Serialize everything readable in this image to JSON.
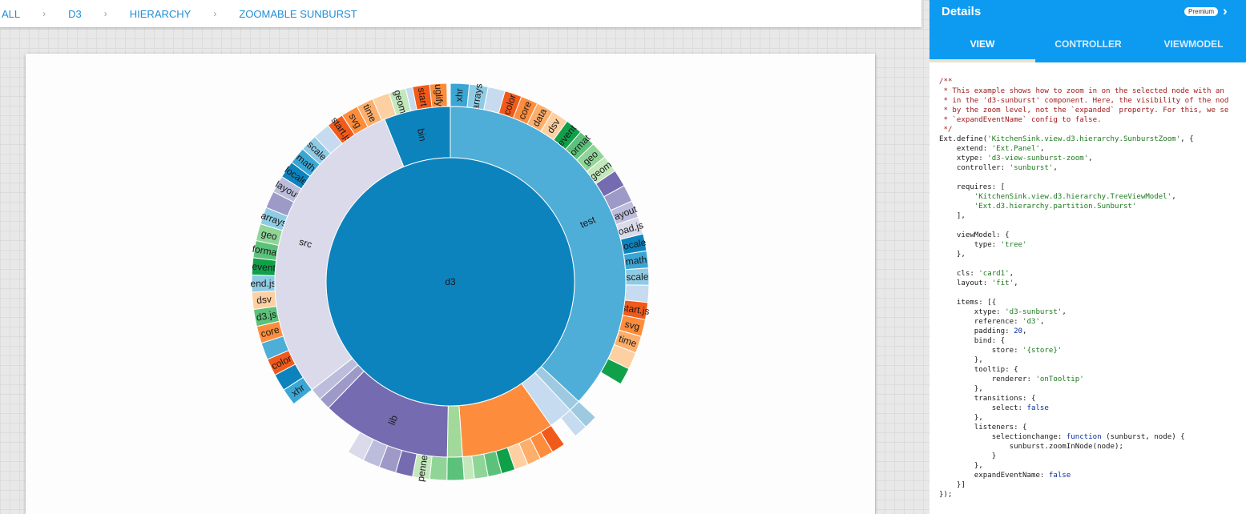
{
  "breadcrumb": [
    "ALL",
    "D3",
    "HIERARCHY",
    "ZOOMABLE SUNBURST"
  ],
  "sunburst": {
    "center_label": "d3",
    "ring1": [
      {
        "label": "test",
        "start": 0,
        "end": 133,
        "color": "#4eaed7"
      },
      {
        "label": "",
        "start": 133,
        "end": 137,
        "color": "#9ecae1"
      },
      {
        "label": "",
        "start": 137,
        "end": 145,
        "color": "#c6dbef"
      },
      {
        "label": "",
        "start": 145,
        "end": 176,
        "color": "#fd8d3c"
      },
      {
        "label": "",
        "start": 176,
        "end": 181,
        "color": "#a1d99b"
      },
      {
        "label": "lib",
        "start": 181,
        "end": 224,
        "color": "#756bb1"
      },
      {
        "label": "",
        "start": 224,
        "end": 228,
        "color": "#9e9ac8"
      },
      {
        "label": "",
        "start": 228,
        "end": 232,
        "color": "#bcbddc"
      },
      {
        "label": "src",
        "start": 232,
        "end": 338,
        "color": "#dadaeb"
      },
      {
        "label": "bin",
        "start": 338,
        "end": 360,
        "color": "#0d83bd"
      }
    ],
    "ring2": [
      {
        "label": "xhr",
        "start": 0,
        "end": 5.5,
        "color": "#3aa6d4"
      },
      {
        "label": "arrays",
        "start": 5.5,
        "end": 11,
        "color": "#8fcbe4"
      },
      {
        "label": "",
        "start": 11,
        "end": 16,
        "color": "#c6dbef"
      },
      {
        "label": "color",
        "start": 16,
        "end": 21,
        "color": "#f15a1a"
      },
      {
        "label": "core",
        "start": 21,
        "end": 26,
        "color": "#fd8d3c"
      },
      {
        "label": "data",
        "start": 26,
        "end": 31,
        "color": "#fdae6b"
      },
      {
        "label": "dsv",
        "start": 31,
        "end": 36,
        "color": "#fdd0a2"
      },
      {
        "label": "event",
        "start": 36,
        "end": 41,
        "color": "#10a04a"
      },
      {
        "label": "format",
        "start": 41,
        "end": 46,
        "color": "#5cc17a"
      },
      {
        "label": "geo",
        "start": 46,
        "end": 51,
        "color": "#8fd598"
      },
      {
        "label": "geom",
        "start": 51,
        "end": 56,
        "color": "#c3e8bc"
      },
      {
        "label": "",
        "start": 56,
        "end": 61,
        "color": "#756bb1"
      },
      {
        "label": "",
        "start": 61,
        "end": 66,
        "color": "#9e9ac8"
      },
      {
        "label": "layout",
        "start": 66,
        "end": 71,
        "color": "#bcbddc"
      },
      {
        "label": "load.js",
        "start": 71,
        "end": 76,
        "color": "#dadaeb"
      },
      {
        "label": "locale",
        "start": 76,
        "end": 81,
        "color": "#0d83bd"
      },
      {
        "label": "math",
        "start": 81,
        "end": 86,
        "color": "#3aa6d4"
      },
      {
        "label": "scale",
        "start": 86,
        "end": 91,
        "color": "#8fcbe4"
      },
      {
        "label": "",
        "start": 91,
        "end": 96,
        "color": "#c6dbef"
      },
      {
        "label": "start.js",
        "start": 96,
        "end": 101,
        "color": "#f15a1a"
      },
      {
        "label": "svg",
        "start": 101,
        "end": 106,
        "color": "#fd8d3c"
      },
      {
        "label": "time",
        "start": 106,
        "end": 111,
        "color": "#fdae6b"
      },
      {
        "label": "",
        "start": 111,
        "end": 116,
        "color": "#fdd0a2"
      },
      {
        "label": "",
        "start": 116,
        "end": 121,
        "color": "#10a04a"
      },
      {
        "label": "",
        "start": 133,
        "end": 137,
        "color": "#9ecae1"
      },
      {
        "label": "",
        "start": 137,
        "end": 141,
        "color": "#c6dbef"
      },
      {
        "label": "",
        "start": 145,
        "end": 149,
        "color": "#f15a1a"
      },
      {
        "label": "",
        "start": 149,
        "end": 153,
        "color": "#fd8d3c"
      },
      {
        "label": "",
        "start": 153,
        "end": 157,
        "color": "#fdae6b"
      },
      {
        "label": "",
        "start": 157,
        "end": 161,
        "color": "#fdd0a2"
      },
      {
        "label": "",
        "start": 161,
        "end": 165,
        "color": "#10a04a"
      },
      {
        "label": "",
        "start": 165,
        "end": 169,
        "color": "#5cc17a"
      },
      {
        "label": "",
        "start": 169,
        "end": 173,
        "color": "#8fd598"
      },
      {
        "label": "",
        "start": 173,
        "end": 176,
        "color": "#c3e8bc"
      },
      {
        "label": "",
        "start": 176,
        "end": 181,
        "color": "#5cc17a"
      },
      {
        "label": "",
        "start": 181,
        "end": 186,
        "color": "#8fd598"
      },
      {
        "label": "penner",
        "start": 186,
        "end": 191,
        "color": "#c3e8bc"
      },
      {
        "label": "",
        "start": 191,
        "end": 196,
        "color": "#756bb1"
      },
      {
        "label": "",
        "start": 196,
        "end": 201,
        "color": "#9e9ac8"
      },
      {
        "label": "",
        "start": 201,
        "end": 206,
        "color": "#bcbddc"
      },
      {
        "label": "",
        "start": 206,
        "end": 211,
        "color": "#dadaeb"
      },
      {
        "label": "xhr",
        "start": 232,
        "end": 237,
        "color": "#3aa6d4"
      },
      {
        "label": "",
        "start": 237,
        "end": 242,
        "color": "#0d83bd"
      },
      {
        "label": "color",
        "start": 242,
        "end": 247,
        "color": "#f15a1a"
      },
      {
        "label": "",
        "start": 247,
        "end": 252,
        "color": "#4eaed7"
      },
      {
        "label": "core",
        "start": 252,
        "end": 257,
        "color": "#fd8d3c"
      },
      {
        "label": "d3.js",
        "start": 257,
        "end": 262,
        "color": "#5cc17a"
      },
      {
        "label": "dsv",
        "start": 262,
        "end": 267,
        "color": "#fdd0a2"
      },
      {
        "label": "end.js",
        "start": 267,
        "end": 272,
        "color": "#8fcbe4"
      },
      {
        "label": "event",
        "start": 272,
        "end": 277,
        "color": "#10a04a"
      },
      {
        "label": "format",
        "start": 277,
        "end": 282,
        "color": "#5cc17a"
      },
      {
        "label": "geo",
        "start": 282,
        "end": 287,
        "color": "#8fd598"
      },
      {
        "label": "arrays",
        "start": 287,
        "end": 292,
        "color": "#8fcbe4"
      },
      {
        "label": "",
        "start": 292,
        "end": 297,
        "color": "#9e9ac8"
      },
      {
        "label": "layout",
        "start": 297,
        "end": 302,
        "color": "#bcbddc"
      },
      {
        "label": "locale",
        "start": 302,
        "end": 307,
        "color": "#0d83bd"
      },
      {
        "label": "math",
        "start": 307,
        "end": 312,
        "color": "#3aa6d4"
      },
      {
        "label": "scale",
        "start": 312,
        "end": 317,
        "color": "#8fcbe4"
      },
      {
        "label": "",
        "start": 317,
        "end": 322,
        "color": "#c6dbef"
      },
      {
        "label": "start.js",
        "start": 322,
        "end": 327,
        "color": "#f15a1a"
      },
      {
        "label": "svg",
        "start": 327,
        "end": 332,
        "color": "#fd8d3c"
      },
      {
        "label": "time",
        "start": 332,
        "end": 337,
        "color": "#fdae6b"
      },
      {
        "label": "",
        "start": 337,
        "end": 342,
        "color": "#fdd0a2"
      },
      {
        "label": "geom",
        "start": 342,
        "end": 347,
        "color": "#c3e8bc"
      },
      {
        "label": "",
        "start": 347,
        "end": 352,
        "color": "#c6dbef"
      },
      {
        "label": "start",
        "start": 349,
        "end": 354,
        "color": "#f15a1a"
      },
      {
        "label": "uglify",
        "start": 354,
        "end": 359,
        "color": "#fd8d3c"
      }
    ]
  },
  "details": {
    "title": "Details",
    "badge": "Premium",
    "tabs": [
      "VIEW",
      "CONTROLLER",
      "VIEWMODEL"
    ],
    "code_lines": [
      [
        {
          "t": "/**",
          "c": "comment"
        }
      ],
      [
        {
          "t": " * This example shows how to zoom in on the selected node with an",
          "c": "comment"
        }
      ],
      [
        {
          "t": " * in the 'd3-sunburst' component. Here, the visibility of the nod",
          "c": "comment"
        }
      ],
      [
        {
          "t": " * by the zoom level, not the `expanded` property. For this, we se",
          "c": "comment"
        }
      ],
      [
        {
          "t": " * `expandEventName` config to false.",
          "c": "comment"
        }
      ],
      [
        {
          "t": " */",
          "c": "comment"
        }
      ],
      [
        {
          "t": "Ext.define(",
          "c": ""
        },
        {
          "t": "'KitchenSink.view.d3.hierarchy.SunburstZoom'",
          "c": "string"
        },
        {
          "t": ", {",
          "c": ""
        }
      ],
      [
        {
          "t": "    extend: ",
          "c": ""
        },
        {
          "t": "'Ext.Panel'",
          "c": "string"
        },
        {
          "t": ",",
          "c": ""
        }
      ],
      [
        {
          "t": "    xtype: ",
          "c": ""
        },
        {
          "t": "'d3-view-sunburst-zoom'",
          "c": "string"
        },
        {
          "t": ",",
          "c": ""
        }
      ],
      [
        {
          "t": "    controller: ",
          "c": ""
        },
        {
          "t": "'sunburst'",
          "c": "string"
        },
        {
          "t": ",",
          "c": ""
        }
      ],
      [
        {
          "t": "",
          "c": ""
        }
      ],
      [
        {
          "t": "    requires: [",
          "c": ""
        }
      ],
      [
        {
          "t": "        ",
          "c": ""
        },
        {
          "t": "'KitchenSink.view.d3.hierarchy.TreeViewModel'",
          "c": "string"
        },
        {
          "t": ",",
          "c": ""
        }
      ],
      [
        {
          "t": "        ",
          "c": ""
        },
        {
          "t": "'Ext.d3.hierarchy.partition.Sunburst'",
          "c": "string"
        }
      ],
      [
        {
          "t": "    ],",
          "c": ""
        }
      ],
      [
        {
          "t": "",
          "c": ""
        }
      ],
      [
        {
          "t": "    viewModel: {",
          "c": ""
        }
      ],
      [
        {
          "t": "        type: ",
          "c": ""
        },
        {
          "t": "'tree'",
          "c": "string"
        }
      ],
      [
        {
          "t": "    },",
          "c": ""
        }
      ],
      [
        {
          "t": "",
          "c": ""
        }
      ],
      [
        {
          "t": "    cls: ",
          "c": ""
        },
        {
          "t": "'card1'",
          "c": "string"
        },
        {
          "t": ",",
          "c": ""
        }
      ],
      [
        {
          "t": "    layout: ",
          "c": ""
        },
        {
          "t": "'fit'",
          "c": "string"
        },
        {
          "t": ",",
          "c": ""
        }
      ],
      [
        {
          "t": "",
          "c": ""
        }
      ],
      [
        {
          "t": "    items: [{",
          "c": ""
        }
      ],
      [
        {
          "t": "        xtype: ",
          "c": ""
        },
        {
          "t": "'d3-sunburst'",
          "c": "string"
        },
        {
          "t": ",",
          "c": ""
        }
      ],
      [
        {
          "t": "        reference: ",
          "c": ""
        },
        {
          "t": "'d3'",
          "c": "string"
        },
        {
          "t": ",",
          "c": ""
        }
      ],
      [
        {
          "t": "        padding: ",
          "c": ""
        },
        {
          "t": "20",
          "c": "key"
        },
        {
          "t": ",",
          "c": ""
        }
      ],
      [
        {
          "t": "        bind: {",
          "c": ""
        }
      ],
      [
        {
          "t": "            store: ",
          "c": ""
        },
        {
          "t": "'{store}'",
          "c": "string"
        }
      ],
      [
        {
          "t": "        },",
          "c": ""
        }
      ],
      [
        {
          "t": "        tooltip: {",
          "c": ""
        }
      ],
      [
        {
          "t": "            renderer: ",
          "c": ""
        },
        {
          "t": "'onTooltip'",
          "c": "string"
        }
      ],
      [
        {
          "t": "        },",
          "c": ""
        }
      ],
      [
        {
          "t": "        transitions: {",
          "c": ""
        }
      ],
      [
        {
          "t": "            select: ",
          "c": ""
        },
        {
          "t": "false",
          "c": "key"
        }
      ],
      [
        {
          "t": "        },",
          "c": ""
        }
      ],
      [
        {
          "t": "        listeners: {",
          "c": ""
        }
      ],
      [
        {
          "t": "            selectionchange: ",
          "c": ""
        },
        {
          "t": "function",
          "c": "fn"
        },
        {
          "t": " (sunburst, node) {",
          "c": ""
        }
      ],
      [
        {
          "t": "                sunburst.zoomInNode(node);",
          "c": ""
        }
      ],
      [
        {
          "t": "            }",
          "c": ""
        }
      ],
      [
        {
          "t": "        },",
          "c": ""
        }
      ],
      [
        {
          "t": "        expandEventName: ",
          "c": ""
        },
        {
          "t": "false",
          "c": "key"
        }
      ],
      [
        {
          "t": "    }]",
          "c": ""
        }
      ],
      [
        {
          "t": "});",
          "c": ""
        }
      ]
    ]
  }
}
